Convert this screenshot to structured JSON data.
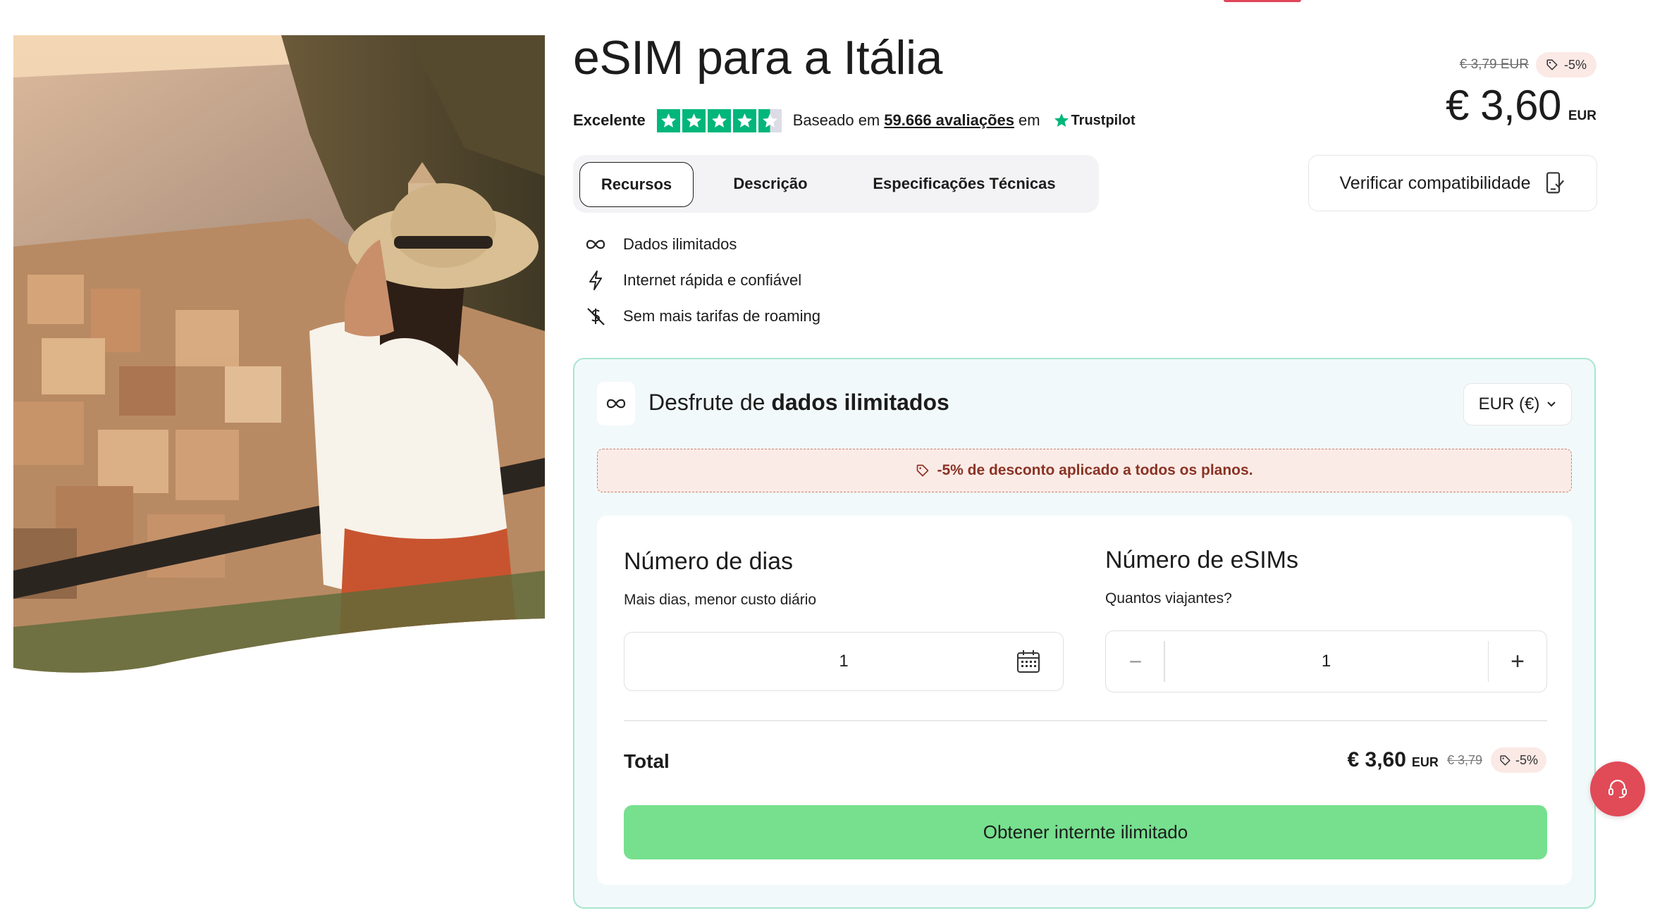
{
  "page": {
    "title": "eSIM para a Itália",
    "accent_color": "#e0445a"
  },
  "hero_image": {
    "description_icon": "travel-photo"
  },
  "rating": {
    "label": "Excelente",
    "stars": 4.5,
    "based_on": "Baseado em",
    "reviews": "59.666 avaliações",
    "on": "em",
    "provider": "Trustpilot",
    "star_color": "#00b67a"
  },
  "price": {
    "old": "€ 3,79 EUR",
    "discount": "-5%",
    "current": "€ 3,60",
    "currency": "EUR"
  },
  "tabs": [
    {
      "label": "Recursos",
      "active": true
    },
    {
      "label": "Descrição",
      "active": false
    },
    {
      "label": "Especificações Técnicas",
      "active": false
    }
  ],
  "compat_button": {
    "label": "Verificar compatibilidade"
  },
  "features": [
    {
      "icon": "infinity-icon",
      "label": "Dados ilimitados"
    },
    {
      "icon": "lightning-icon",
      "label": "Internet rápida e confiável"
    },
    {
      "icon": "no-roaming-icon",
      "label": "Sem mais tarifas de roaming"
    }
  ],
  "card": {
    "title_prefix": "Desfrute de",
    "title_bold": "dados ilimitados",
    "currency_select": "EUR (€)",
    "banner": "-5% de desconto aplicado a todos os planos.",
    "border_color": "#a8e6cd",
    "background": "#f2f9fb"
  },
  "days": {
    "title": "Número de dias",
    "subtitle": "Mais dias, menor custo diário",
    "value": "1"
  },
  "esims": {
    "title": "Número de eSIMs",
    "subtitle": "Quantos viajantes?",
    "value": "1",
    "minus": "−",
    "plus": "+"
  },
  "total": {
    "label": "Total",
    "price": "€ 3,60",
    "currency": "EUR",
    "old": "€ 3,79",
    "discount": "-5%"
  },
  "cta": {
    "label": "Obtener internte ilimitado",
    "color": "#76e08e"
  },
  "help_button": {
    "icon": "support-headset-icon",
    "color": "#e14a57"
  }
}
